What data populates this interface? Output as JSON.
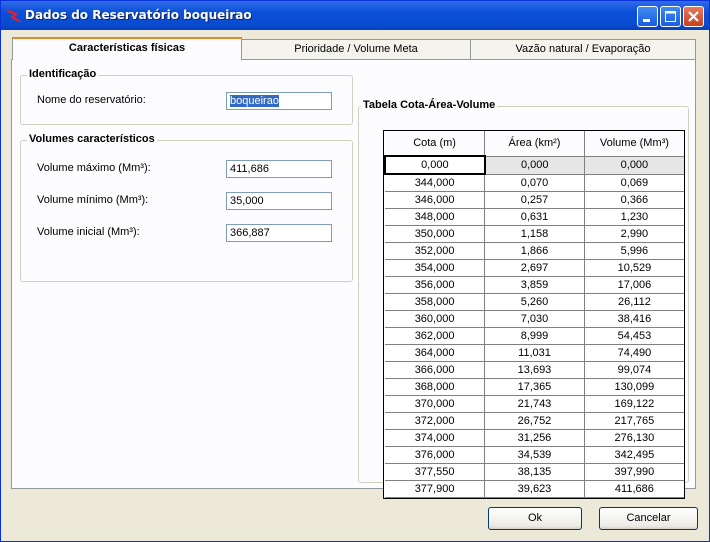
{
  "window": {
    "title": "Dados do Reservatório boqueirao",
    "colors": {
      "titlebar": "#0a4fd6",
      "face": "#ece9d8",
      "tab_accent": "#e68b2c"
    }
  },
  "tabs": [
    {
      "label": "Características físicas",
      "active": true
    },
    {
      "label": "Prioridade / Volume Meta",
      "active": false
    },
    {
      "label": "Vazão natural / Evaporação",
      "active": false
    }
  ],
  "identificacao": {
    "title": "Identificação",
    "nome_label": "Nome do reservatório:",
    "nome_value": "boqueirao"
  },
  "volumes": {
    "title": "Volumes característicos",
    "max_label": "Volume máximo (Mm³):",
    "max_value": "411,686",
    "min_label": "Volume mínimo (Mm³):",
    "min_value": "35,000",
    "inicial_label": "Volume inicial (Mm³):",
    "inicial_value": "366,887"
  },
  "tabela": {
    "title": "Tabela Cota-Área-Volume",
    "columns": [
      "Cota (m)",
      "Área (km²)",
      "Volume (Mm³)"
    ],
    "rows": [
      [
        "0,000",
        "0,000",
        "0,000"
      ],
      [
        "344,000",
        "0,070",
        "0,069"
      ],
      [
        "346,000",
        "0,257",
        "0,366"
      ],
      [
        "348,000",
        "0,631",
        "1,230"
      ],
      [
        "350,000",
        "1,158",
        "2,990"
      ],
      [
        "352,000",
        "1,866",
        "5,996"
      ],
      [
        "354,000",
        "2,697",
        "10,529"
      ],
      [
        "356,000",
        "3,859",
        "17,006"
      ],
      [
        "358,000",
        "5,260",
        "26,112"
      ],
      [
        "360,000",
        "7,030",
        "38,416"
      ],
      [
        "362,000",
        "8,999",
        "54,453"
      ],
      [
        "364,000",
        "11,031",
        "74,490"
      ],
      [
        "366,000",
        "13,693",
        "99,074"
      ],
      [
        "368,000",
        "17,365",
        "130,099"
      ],
      [
        "370,000",
        "21,743",
        "169,122"
      ],
      [
        "372,000",
        "26,752",
        "217,765"
      ],
      [
        "374,000",
        "31,256",
        "276,130"
      ],
      [
        "376,000",
        "34,539",
        "342,495"
      ],
      [
        "377,550",
        "38,135",
        "397,990"
      ],
      [
        "377,900",
        "39,623",
        "411,686"
      ]
    ]
  },
  "buttons": {
    "ok": "Ok",
    "cancel": "Cancelar"
  }
}
